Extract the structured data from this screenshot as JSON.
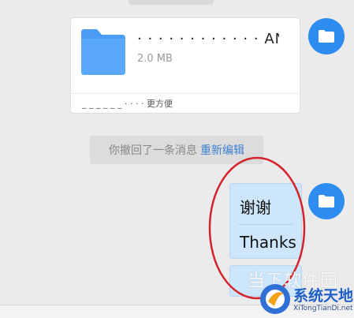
{
  "file_card": {
    "name": "· · · · ·   · · · · · · · AN",
    "size": "2.0 MB",
    "footer_text": "_ _ _ _ _ _   ·   · ·  · 更方便"
  },
  "recall_notice": {
    "text": "你撤回了一条消息",
    "reedit_label": "重新编辑"
  },
  "message": {
    "lines": [
      "谢谢",
      "Thanks"
    ]
  },
  "watermark": {
    "faded_text": "当下软件园",
    "brand": "系统天地",
    "domain": "XiTongTianDi.net"
  },
  "colors": {
    "accent": "#2d8cf0",
    "bubble": "#cde6fb",
    "annotation": "#d4232b"
  }
}
